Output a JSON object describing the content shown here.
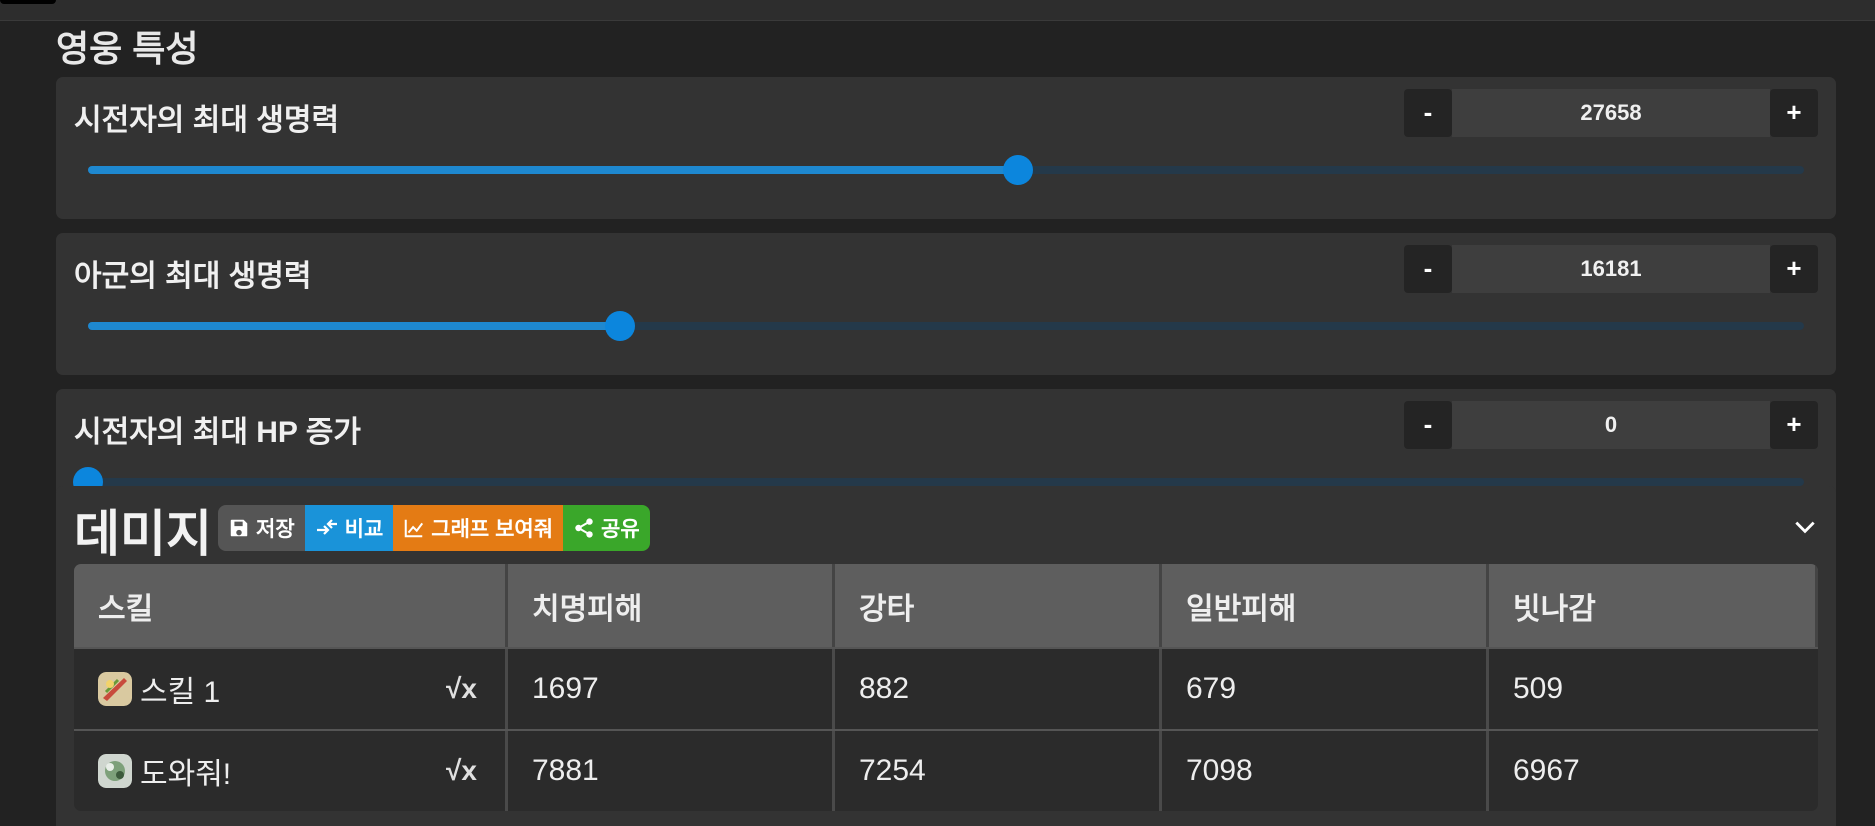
{
  "section_title": "영웅 특성",
  "sliders": [
    {
      "label": "시전자의 최대 생명력",
      "value": "27658",
      "fill": 0.542
    },
    {
      "label": "아군의 최대 생명력",
      "value": "16181",
      "fill": 0.31
    },
    {
      "label": "시전자의 최대 HP 증가",
      "value": "0",
      "fill": 0.0
    }
  ],
  "stepper": {
    "minus": "-",
    "plus": "+"
  },
  "damage": {
    "title": "데미지",
    "buttons": {
      "save": "저장",
      "compare": "비교",
      "graph": "그래프 보여줘",
      "share": "공유"
    },
    "headers": [
      "스킬",
      "치명피해",
      "강타",
      "일반피해",
      "빗나감"
    ],
    "rows": [
      {
        "skill": "스킬 1",
        "crit": "1697",
        "crush": "882",
        "normal": "679",
        "miss": "509",
        "icon": "skill-1-icon"
      },
      {
        "skill": "도와줘!",
        "crit": "7881",
        "crush": "7254",
        "normal": "7098",
        "miss": "6967",
        "icon": "skill-help-icon"
      }
    ],
    "formula_symbol": "√x"
  },
  "colors": {
    "accent": "#0c86dd",
    "compare": "#1a93d9",
    "graph": "#e47b14",
    "share": "#3aa72a"
  }
}
